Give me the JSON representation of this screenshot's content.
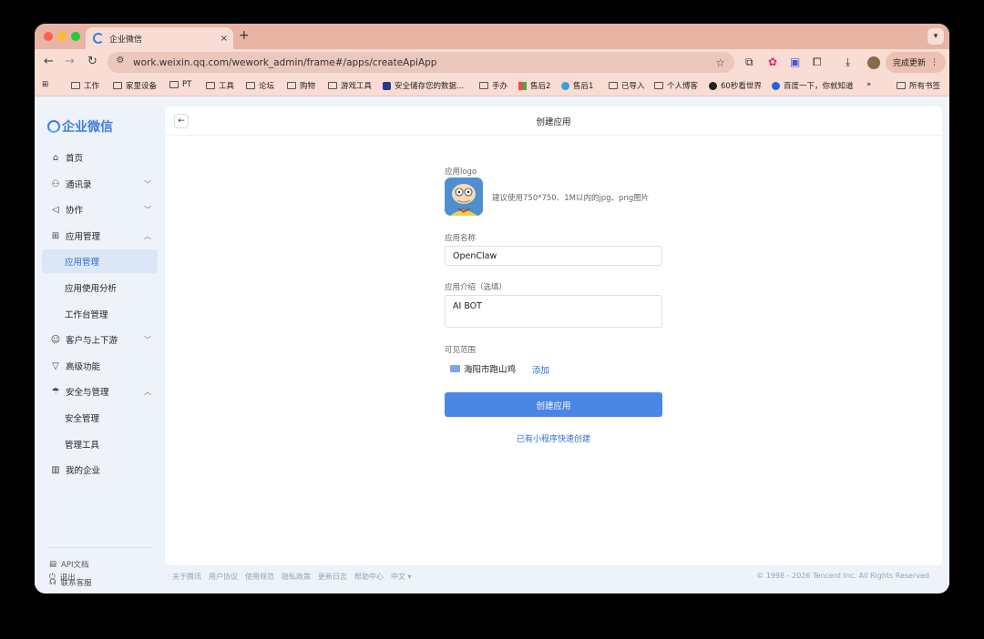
{
  "browser": {
    "tab_title": "企业微信",
    "tab_close": "×",
    "new_tab": "+",
    "url": "work.weixin.qq.com/wework_admin/frame#/apps/createApiApp",
    "update_button": "完成更新",
    "bookmarks": [
      "工作",
      "家里设备",
      "PT",
      "工具",
      "论坛",
      "购物",
      "游戏工具",
      "安全储存您的数据...",
      "手办",
      "售后2",
      "售后1",
      "已导入",
      "个人博客",
      "60秒看世界",
      "百度一下，你就知道"
    ],
    "bookmarks_more": "»",
    "all_bookmarks": "所有书签"
  },
  "sidebar": {
    "logo_text": "企业微信",
    "items": [
      {
        "label": "首页",
        "icon": "home-icon"
      },
      {
        "label": "通讯录",
        "icon": "org-icon"
      },
      {
        "label": "协作",
        "icon": "collab-icon"
      },
      {
        "label": "应用管理",
        "icon": "apps-icon"
      },
      {
        "label": "应用管理"
      },
      {
        "label": "应用使用分析"
      },
      {
        "label": "工作台管理"
      },
      {
        "label": "客户与上下游",
        "icon": "chat-icon"
      },
      {
        "label": "高级功能",
        "icon": "filter-icon"
      },
      {
        "label": "安全与管理",
        "icon": "umbrella-icon"
      },
      {
        "label": "安全管理"
      },
      {
        "label": "管理工具"
      },
      {
        "label": "我的企业",
        "icon": "building-icon"
      }
    ],
    "footer": {
      "api_docs": "API文档",
      "support": "联系客服",
      "logout": "退出"
    }
  },
  "main": {
    "title": "创建应用",
    "logo_label": "应用logo",
    "logo_hint": "建议使用750*750、1M以内的jpg、png图片",
    "name_label": "应用名称",
    "name_value": "OpenClaw",
    "intro_label": "应用介绍（选填）",
    "intro_value": "AI BOT",
    "scope_label": "可见范围",
    "scope_tag": "海阳市跑山鸡",
    "add_link": "添加",
    "create_button": "创建应用",
    "mini_link": "已有小程序快速创建"
  },
  "footer": {
    "links": [
      "关于腾讯",
      "用户协议",
      "使用规范",
      "隐私政策",
      "更新日志",
      "帮助中心",
      "中文 ▾"
    ],
    "copyright": "© 1998 - 2026 Tencent Inc. All Rights Reserved"
  },
  "colors": {
    "accent": "#4a86e6",
    "link": "#2f6ed6",
    "tabbar": "#e8b4a4"
  }
}
